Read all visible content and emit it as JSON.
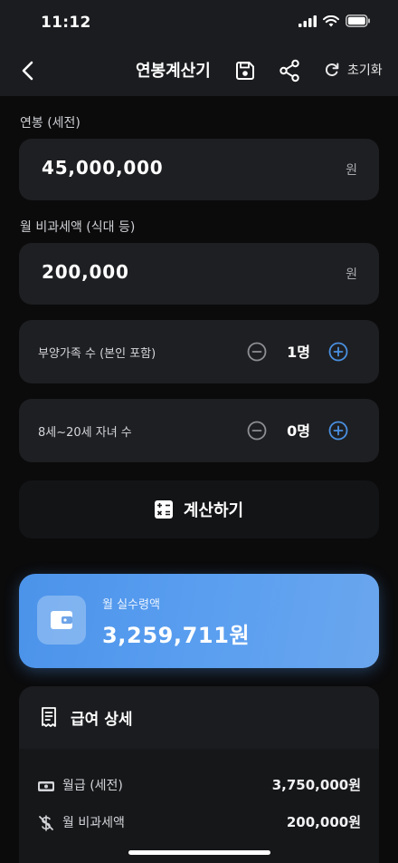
{
  "status_bar": {
    "time": "11:12"
  },
  "nav": {
    "title": "연봉계산기",
    "reset_label": "초기화"
  },
  "annual_salary": {
    "label": "연봉 (세전)",
    "value": "45,000,000",
    "unit": "원"
  },
  "tax_free": {
    "label": "월 비과세액 (식대 등)",
    "value": "200,000",
    "unit": "원"
  },
  "dependents": {
    "label": "부양가족 수 (본인 포함)",
    "value": "1명"
  },
  "children": {
    "label": "8세~20세 자녀 수",
    "value": "0명"
  },
  "calculate_label": "계산하기",
  "result": {
    "label": "월 실수령액",
    "value": "3,259,711원"
  },
  "details": {
    "title": "급여 상세",
    "rows": [
      {
        "label": "월급 (세전)",
        "value": "3,750,000원",
        "icon": "cash-icon"
      },
      {
        "label": "월 비과세액",
        "value": "200,000원",
        "icon": "no-tax-icon"
      }
    ]
  },
  "colors": {
    "accent": "#4A90E2",
    "background": "#0B0B0C",
    "card": "#1E1F22"
  }
}
